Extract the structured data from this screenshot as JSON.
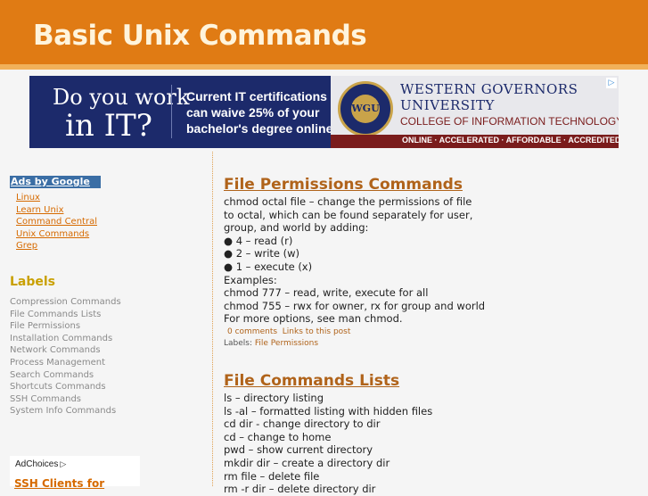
{
  "site": {
    "title": "Basic Unix Commands"
  },
  "banner": {
    "question_line1": "Do you work",
    "question_line2": "in IT?",
    "middle_lines": [
      "Current IT certifications",
      "can waive 25% of your",
      "bachelor's degree online."
    ],
    "seal_text": "WGU",
    "school_line1": "WESTERN GOVERNORS",
    "school_line2": "UNIVERSITY",
    "college": "COLLEGE OF INFORMATION TECHNOLOGY",
    "tagline": "ONLINE  ·  ACCELERATED  ·  AFFORDABLE  ·  ACCREDITED",
    "adchoices_marker": "▷"
  },
  "sidebar": {
    "ads_heading": "Ads by Google",
    "ad_links": [
      "Linux",
      "Learn Unix",
      "Command Central",
      "Unix Commands",
      "Grep"
    ],
    "labels_heading": "Labels",
    "labels": [
      "Compression Commands",
      "File Commands Lists",
      "File Permissions",
      "Installation Commands",
      "Network Commands",
      "Process Management",
      "Search Commands",
      "Shortcuts Commands",
      "SSH Commands",
      "System Info Commands"
    ],
    "adchoices_label": "AdChoices",
    "adchoices_icon": "▷",
    "ad_link_bottom": "SSH Clients for"
  },
  "posts": [
    {
      "title": "File Permissions Commands",
      "lines": [
        "chmod octal file – change the permissions of file",
        "to octal, which can be found separately for user,",
        "group, and world by adding:",
        "● 4 – read (r)",
        "● 2 – write (w)",
        "● 1 – execute (x)",
        "Examples:",
        "chmod 777 – read, write, execute for all",
        "chmod 755 – rwx for owner, rx for group and world",
        "For more options, see man chmod."
      ],
      "comments_label": "0 comments",
      "links_label": "Links to this post",
      "labels_prefix": "Labels:",
      "label": "File Permissions"
    },
    {
      "title": "File Commands Lists",
      "lines": [
        "ls – directory listing",
        "ls -al – formatted listing with hidden files",
        "cd dir - change directory to dir",
        "cd – change to home",
        "pwd – show current directory",
        "mkdir dir – create a directory dir",
        "rm file – delete file",
        "rm -r dir – delete directory dir"
      ]
    }
  ]
}
